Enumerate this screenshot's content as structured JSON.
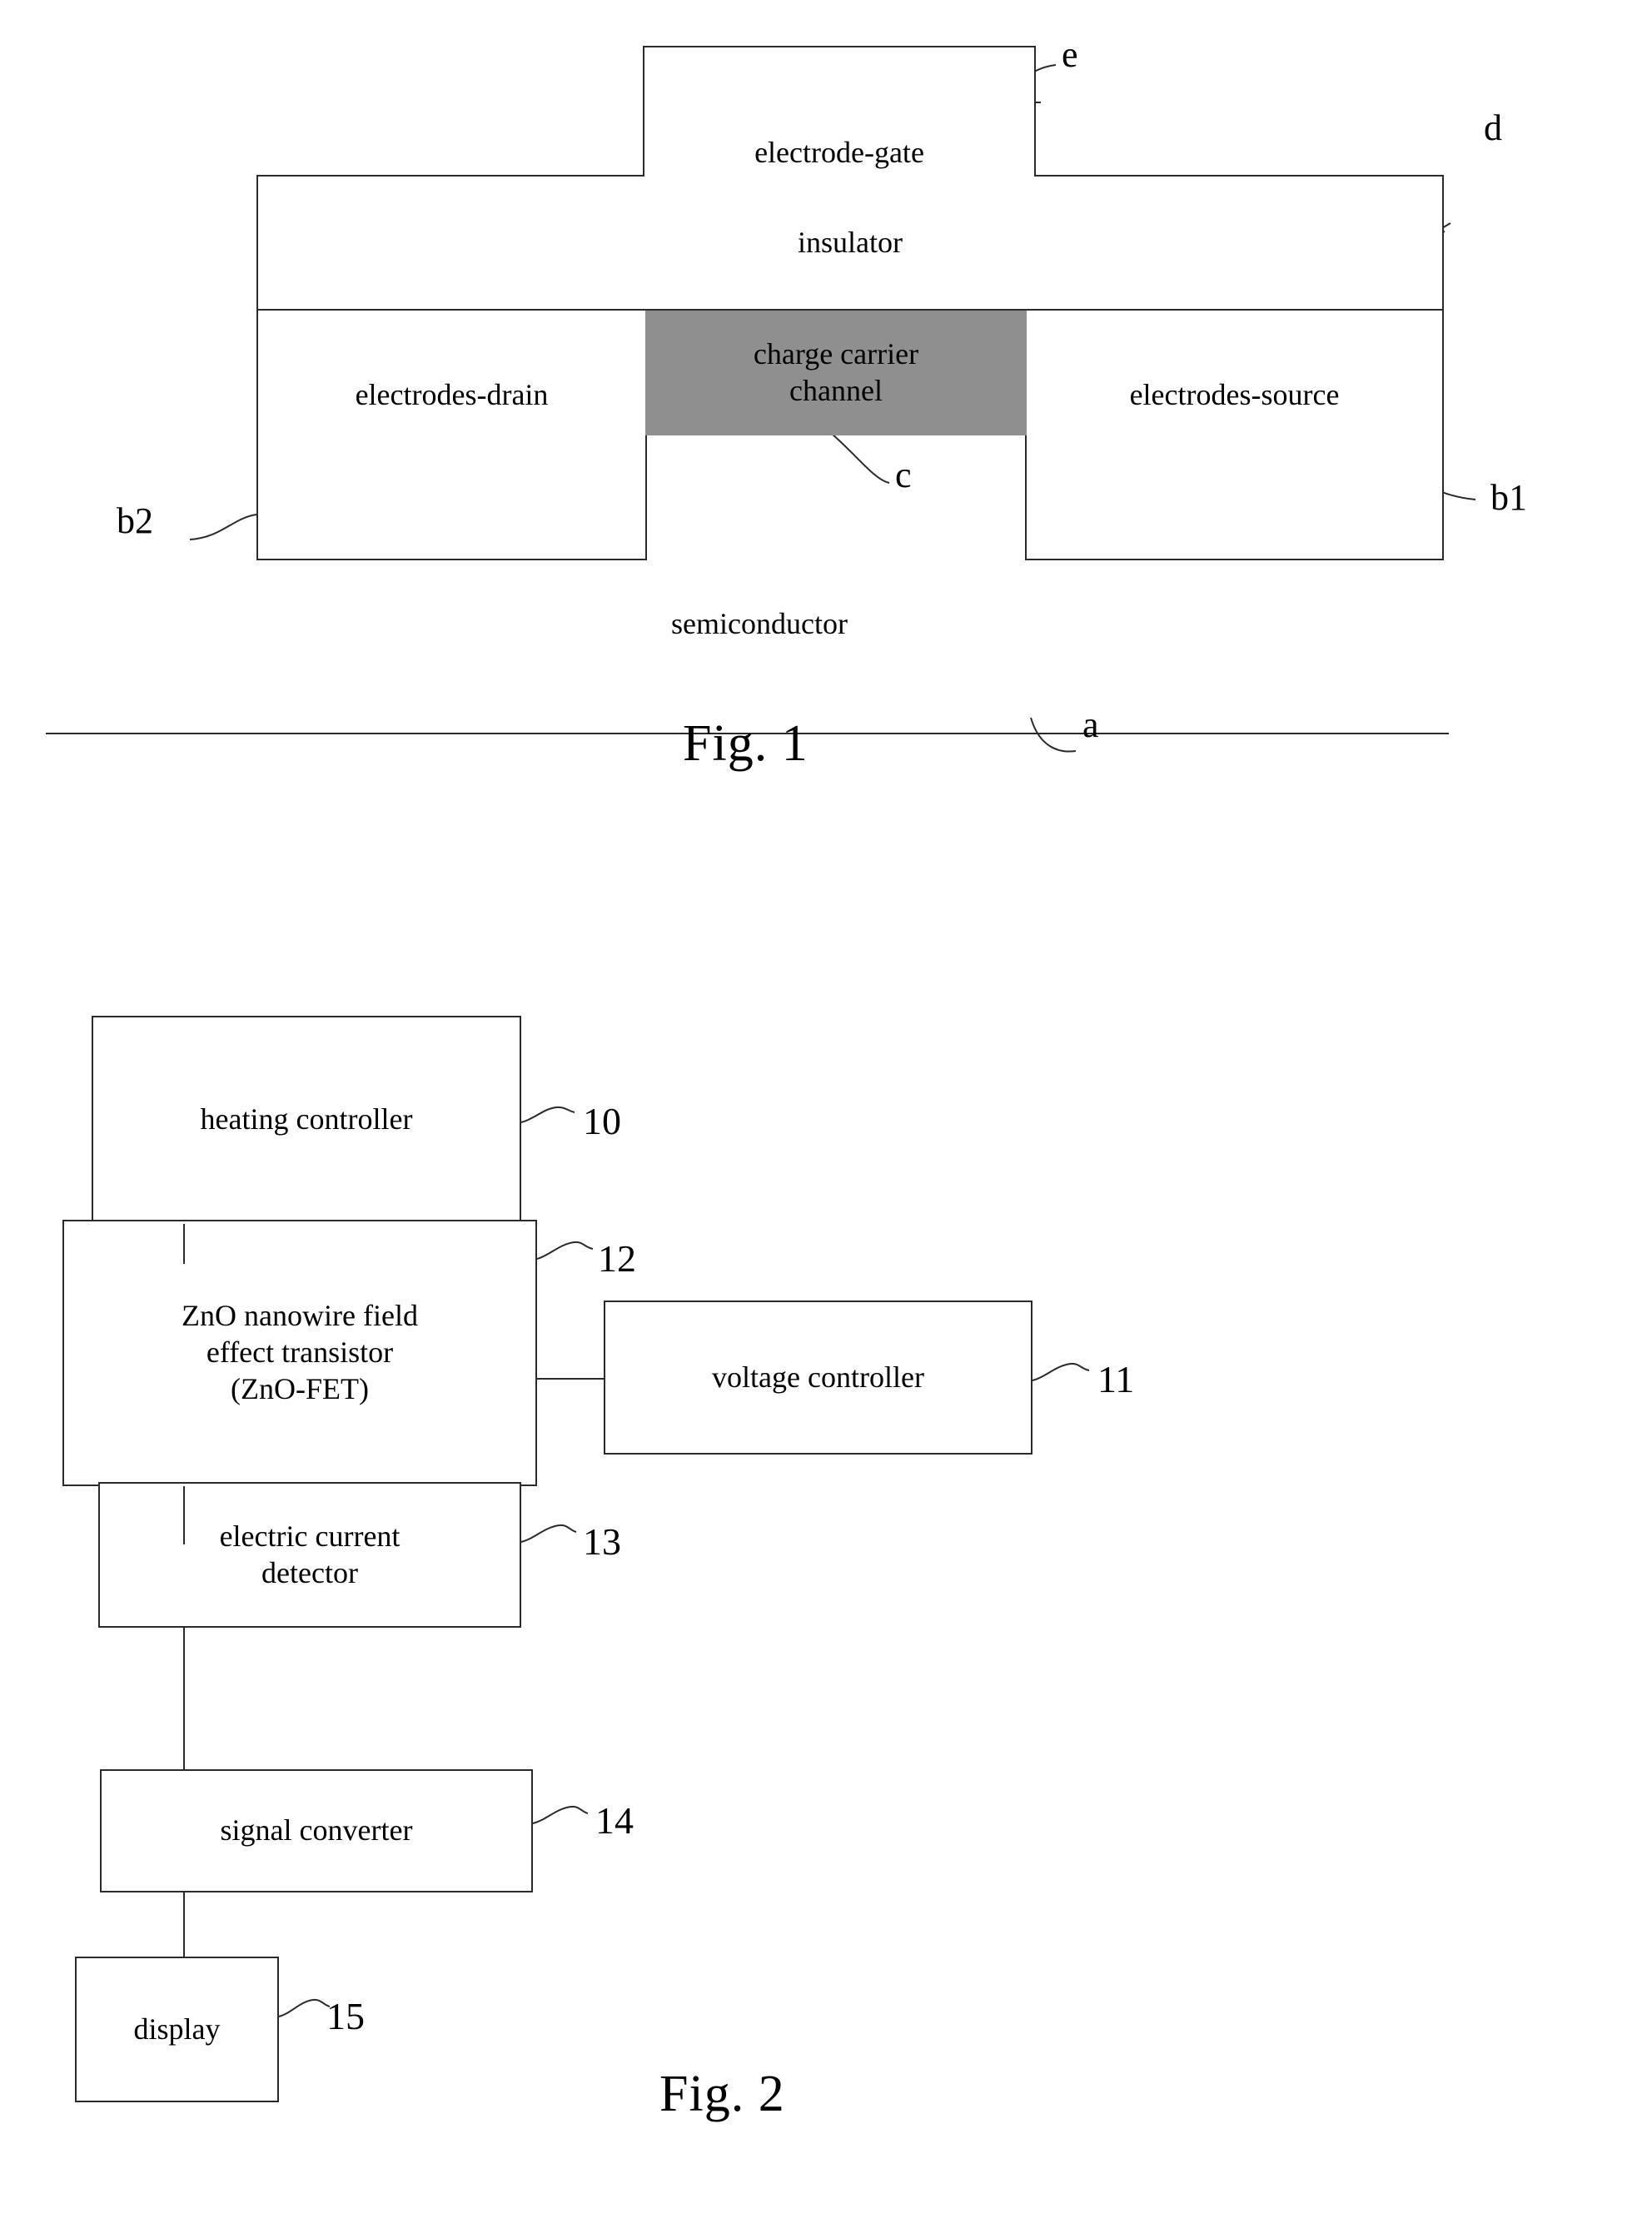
{
  "figure1": {
    "caption": "Fig. 1",
    "blocks": {
      "gate": "electrode-gate",
      "insulator": "insulator",
      "drain": "electrodes-drain",
      "channel": "charge carrier\nchannel",
      "channel_line1": "charge carrier",
      "channel_line2": "channel",
      "source": "electrodes-source",
      "semiconductor": "semiconductor"
    },
    "reference_labels": {
      "gate": "e",
      "insulator": "d",
      "channel": "c",
      "source": "b1",
      "drain": "b2",
      "semiconductor": "a"
    },
    "colors": {
      "channel_fill": "#8f8f8f",
      "line": "#2a2a2a",
      "background": "#ffffff"
    }
  },
  "figure2": {
    "caption": "Fig. 2",
    "blocks": [
      {
        "id": "10",
        "label": "heating controller"
      },
      {
        "id": "12",
        "label": "ZnO nanowire field\neffect transistor\n(ZnO-FET)",
        "line1": "ZnO nanowire field",
        "line2": "effect transistor",
        "line3": "(ZnO-FET)"
      },
      {
        "id": "11",
        "label": "voltage controller"
      },
      {
        "id": "13",
        "label": "electric current\ndetector",
        "line1": "electric current",
        "line2": "detector"
      },
      {
        "id": "14",
        "label": "signal converter"
      },
      {
        "id": "15",
        "label": "display"
      }
    ],
    "reference_labels": {
      "heating_controller": "10",
      "voltage_controller": "11",
      "zno_fet": "12",
      "current_detector": "13",
      "signal_converter": "14",
      "display": "15"
    },
    "colors": {
      "line": "#2a2a2a",
      "background": "#ffffff"
    }
  }
}
